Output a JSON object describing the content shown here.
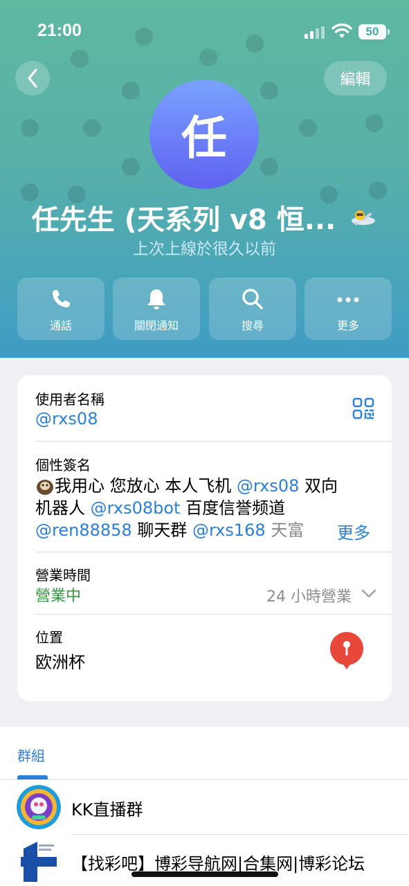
{
  "status_bar": {
    "time": "21:00",
    "battery": "50"
  },
  "header": {
    "back_icon": "chevron-left-icon",
    "edit_label": "編輯",
    "avatar_letter": "任",
    "name": "任先生 (天系列 v8 恒...",
    "last_seen": "上次上線於很久以前"
  },
  "actions": [
    {
      "label": "通話",
      "icon": "phone-icon"
    },
    {
      "label": "關閉通知",
      "icon": "bell-icon"
    },
    {
      "label": "搜尋",
      "icon": "search-icon"
    },
    {
      "label": "更多",
      "icon": "more-icon"
    }
  ],
  "info": {
    "username_label": "使用者名稱",
    "username": "@rxs08",
    "bio_label": "個性簽名",
    "bio_line1_prefix": "我用心 您放心 本人飞机 ",
    "bio_line1_link": "@rxs08",
    "bio_line1_suffix": " 双向",
    "bio_line2_prefix": "机器人 ",
    "bio_line2_link": "@rxs08bot",
    "bio_line2_suffix": " 百度信誉频道",
    "bio_line3_link1": "@ren88858",
    "bio_line3_mid": " 聊天群 ",
    "bio_line3_link2": "@rxs168",
    "bio_line3_suffix": " 天富 ",
    "bio_more": "更多",
    "hours_label": "營業時間",
    "hours_status": "營業中",
    "hours_value": "24 小時營業",
    "location_label": "位置",
    "location_value": "欧洲杯",
    "status_open_color": "#2e9e3e",
    "pin_color": "#e8483c"
  },
  "groups": {
    "tab_label": "群組",
    "items": [
      {
        "name": "KK直播群"
      },
      {
        "name": "【找彩吧】博彩导航网|合集网|博彩论坛"
      }
    ]
  },
  "colors": {
    "accent": "#2a7fd8",
    "header_top": "#5fb8a0",
    "header_bottom": "#3f9cc4",
    "avatar": "#6f7cf5"
  }
}
